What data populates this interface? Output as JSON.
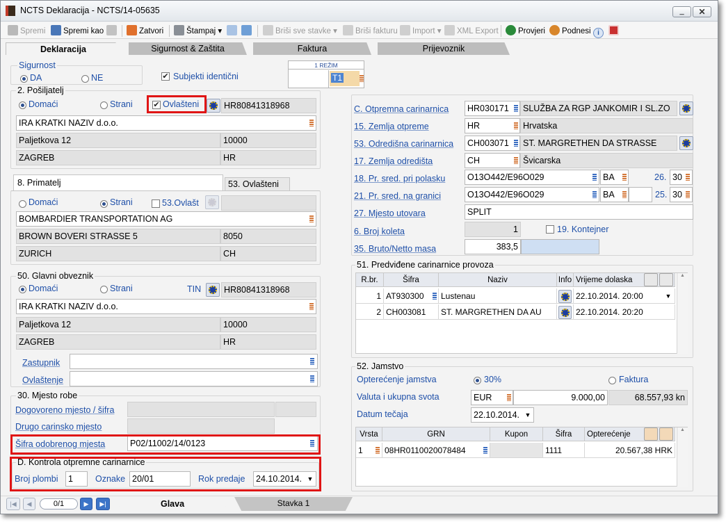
{
  "window": {
    "title": "NCTS Deklaracija - NCTS/14-05635"
  },
  "toolbar": {
    "spremi": "Spremi",
    "spremi_kao": "Spremi kao",
    "zatvori": "Zatvori",
    "stampaj": "Štampaj",
    "brisi_stavke": "Briši sve stavke",
    "brisi_fakturu": "Briši fakturu",
    "import": "Import",
    "xml_export": "XML Export",
    "provjeri": "Provjeri",
    "podnesi": "Podnesi",
    "info": "i"
  },
  "tabs": [
    "Deklaracija",
    "Sigurnost & Zaštita",
    "Faktura",
    "Prijevoznik"
  ],
  "sigurnost": {
    "label": "Sigurnost",
    "da": "DA",
    "ne": "NE",
    "selected": "DA"
  },
  "subjekti": {
    "label": "Subjekti identični",
    "checked": true
  },
  "rezim": {
    "label": "1 REŽIM",
    "value": "T1"
  },
  "posiljatelj": {
    "title": "2. Pošiljatelj",
    "domaci": "Domaći",
    "strani": "Strani",
    "ovlasteni": "Ovlašteni",
    "id": "HR80841318968",
    "naziv": "IRA KRATKI NAZIV d.o.o.",
    "adresa": "Paljetkova 12",
    "postanski": "10000",
    "grad": "ZAGREB",
    "drzava": "HR"
  },
  "primatelj": {
    "title": "8. Primatelj",
    "tab2": "53. Ovlašteni",
    "domaci": "Domaći",
    "strani": "Strani",
    "ovlast": "53.Ovlašt",
    "naziv": "BOMBARDIER TRANSPORTATION AG",
    "adresa": "BROWN BOVERI STRASSE 5",
    "postanski": "8050",
    "grad": "ZURICH",
    "drzava": "CH"
  },
  "obveznik": {
    "title": "50. Glavni obveznik",
    "domaci": "Domaći",
    "strani": "Strani",
    "tin": "TIN",
    "id": "HR80841318968",
    "naziv": "IRA KRATKI NAZIV d.o.o.",
    "adresa": "Paljetkova 12",
    "postanski": "10000",
    "grad": "ZAGREB",
    "drzava": "HR",
    "zastupnik": "Zastupnik",
    "ovlastenje": "Ovlaštenje"
  },
  "mjesto_robe": {
    "title": "30. Mjesto robe",
    "dogovoreno": "Dogovoreno mjesto / šifra",
    "drugo": "Drugo carinsko mjesto",
    "sifra_label": "Šifra odobrenog mjesta",
    "sifra": "P02/11002/14/0123"
  },
  "kontrola": {
    "title": "D. Kontrola otpremne carinarnice",
    "plombi_label": "Broj plombi",
    "plombi": "1",
    "oznake_label": "Oznake",
    "oznake": "20/01",
    "rok_label": "Rok predaje",
    "rok": "24.10.2014."
  },
  "right": {
    "otpremna_label": "C. Otpremna carinarnica",
    "otpremna_sifra": "HR030171",
    "otpremna_naziv": "SLUŽBA ZA RGP JANKOMIR I SL.ZO",
    "zemlja_otpreme_label": "15. Zemlja otpreme",
    "zemlja_otpreme_sifra": "HR",
    "zemlja_otpreme_naziv": "Hrvatska",
    "odredisna_label": "53. Odredišna carinarnica",
    "odredisna_sifra": "CH003071",
    "odredisna_naziv": "ST. MARGRETHEN DA STRASSE",
    "zemlja_odredista_label": "17. Zemlja odredišta",
    "zemlja_odredista_sifra": "CH",
    "zemlja_odredista_naziv": "Švicarska",
    "polazak_label": "18. Pr. sred. pri polasku",
    "polazak": "O13O442/E96O029",
    "polazak_drz": "BA",
    "polazak_no_label": "26.",
    "polazak_no": "30",
    "granica_label": "21. Pr. sred. na granici",
    "granica": "O13O442/E96O029",
    "granica_drz": "BA",
    "granica_no_label": "25.",
    "granica_no": "30",
    "utovar_label": "27. Mjesto utovara",
    "utovar": "SPLIT",
    "koleta_label": "6. Broj koleta",
    "koleta": "1",
    "kontejner": "19. Kontejner",
    "masa_label": "35. Bruto/Netto masa",
    "masa": "383,5"
  },
  "provoz": {
    "title": "51. Predviđene carinarnice provoza",
    "headers": [
      "R.br.",
      "Šifra",
      "Naziv",
      "Info",
      "Vrijeme dolaska"
    ],
    "rows": [
      {
        "rb": "1",
        "sifra": "AT930300",
        "naziv": "Lustenau",
        "vrijeme": "22.10.2014. 20:00"
      },
      {
        "rb": "2",
        "sifra": "CH003081",
        "naziv": "ST. MARGRETHEN DA AU",
        "vrijeme": "22.10.2014. 20:20"
      }
    ]
  },
  "jamstvo": {
    "title": "52. Jamstvo",
    "opterecenje_label": "Opterećenje jamstva",
    "opt30": "30%",
    "faktura": "Faktura",
    "valuta_label": "Valuta i ukupna svota",
    "valuta": "EUR",
    "svota": "9.000,00",
    "kn": "68.557,93 kn",
    "datum_label": "Datum tečaja",
    "datum": "22.10.2014.",
    "headers": [
      "Vrsta",
      "GRN",
      "Kupon",
      "Šifra",
      "Opterećenje"
    ],
    "rows": [
      {
        "vrsta": "1",
        "grn": "08HR0110020078484",
        "kupon": "",
        "sifra": "1111",
        "opterecenje": "20.567,38 HRK"
      }
    ]
  },
  "footer": {
    "page": "0/1",
    "glava": "Glava",
    "stavka": "Stavka 1"
  }
}
